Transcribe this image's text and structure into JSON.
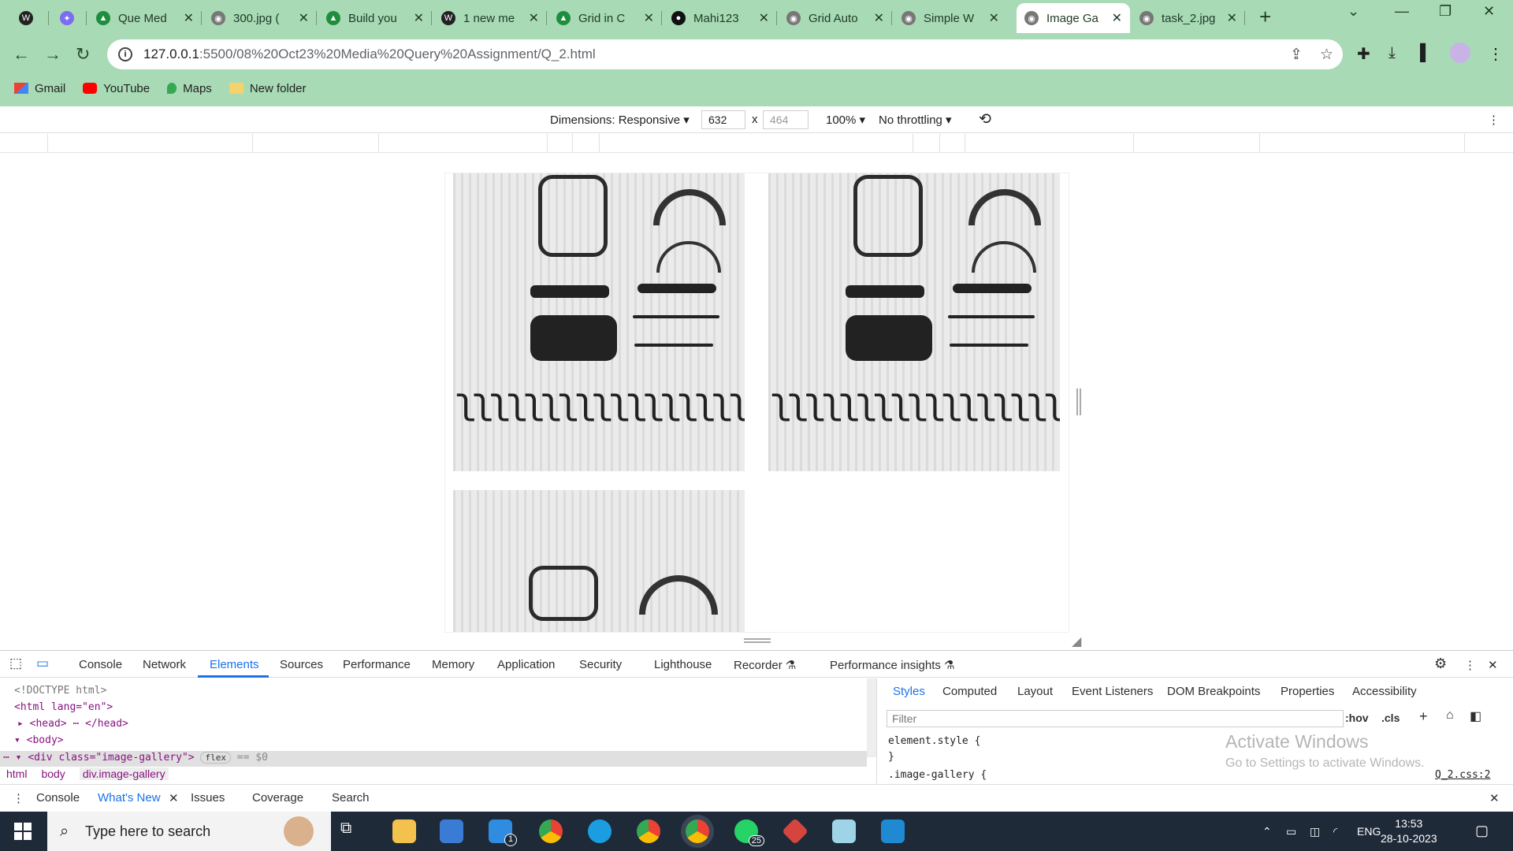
{
  "browser": {
    "tabs": [
      {
        "title": "",
        "favicon": "wordpress-icon"
      },
      {
        "title": "",
        "favicon": "sparkle-icon"
      },
      {
        "title": "Que Med",
        "favicon": "google-drive-icon"
      },
      {
        "title": "300.jpg (",
        "favicon": "globe-icon"
      },
      {
        "title": "Build you",
        "favicon": "google-drive-icon"
      },
      {
        "title": "1 new me",
        "favicon": "wordpress-icon"
      },
      {
        "title": "Grid in C",
        "favicon": "google-drive-icon"
      },
      {
        "title": "Mahi123",
        "favicon": "github-icon"
      },
      {
        "title": "Grid Auto",
        "favicon": "globe-icon"
      },
      {
        "title": "Simple W",
        "favicon": "globe-icon"
      },
      {
        "title": "Image Ga",
        "favicon": "globe-icon",
        "active": true
      },
      {
        "title": "task_2.jpg",
        "favicon": "globe-icon"
      }
    ],
    "url_host": "127.0.0.1",
    "url_path": ":5500/08%20Oct23%20Media%20Query%20Assignment/Q_2.html",
    "bookmarks": [
      {
        "label": "Gmail",
        "icon": "gmail-icon"
      },
      {
        "label": "YouTube",
        "icon": "youtube-icon"
      },
      {
        "label": "Maps",
        "icon": "maps-icon"
      },
      {
        "label": "New folder",
        "icon": "folder-icon"
      }
    ]
  },
  "device_toolbar": {
    "dimensions_label": "Dimensions: Responsive",
    "width": "632",
    "times": "x",
    "height_placeholder": "464",
    "zoom": "100%",
    "throttling": "No throttling"
  },
  "devtools": {
    "tabs": [
      "Console",
      "Network",
      "Elements",
      "Sources",
      "Performance",
      "Memory",
      "Application",
      "Security",
      "Lighthouse",
      "Recorder",
      "Performance insights"
    ],
    "active_tab": "Elements",
    "dom_lines": {
      "doctype": "<!DOCTYPE html>",
      "html_open": "<html lang=\"en\">",
      "head": "<head> ⋯ </head>",
      "body": "<body>",
      "div": "<div class=\"image-gallery\">",
      "flex_badge": "flex",
      "eq": "== $0"
    },
    "breadcrumbs": [
      "html",
      "body",
      "div.image-gallery"
    ],
    "styles_tabs": [
      "Styles",
      "Computed",
      "Layout",
      "Event Listeners",
      "DOM Breakpoints",
      "Properties",
      "Accessibility"
    ],
    "filter_placeholder": "Filter",
    "hov": ":hov",
    "cls": ".cls",
    "element_style": "element.style {",
    "close_brace": "}",
    "rule_selector": ".image-gallery {",
    "rule_source": "Q_2.css:2",
    "drawer_tabs": [
      "Console",
      "What's New",
      "Issues",
      "Coverage",
      "Search"
    ],
    "drawer_active": "What's New"
  },
  "watermark": {
    "line1": "Activate Windows",
    "line2": "Go to Settings to activate Windows."
  },
  "taskbar": {
    "search_placeholder": "Type here to search",
    "mail_badge": "1",
    "whatsapp_badge": "25",
    "lang": "ENG",
    "time": "13:53",
    "date": "28-10-2023"
  }
}
